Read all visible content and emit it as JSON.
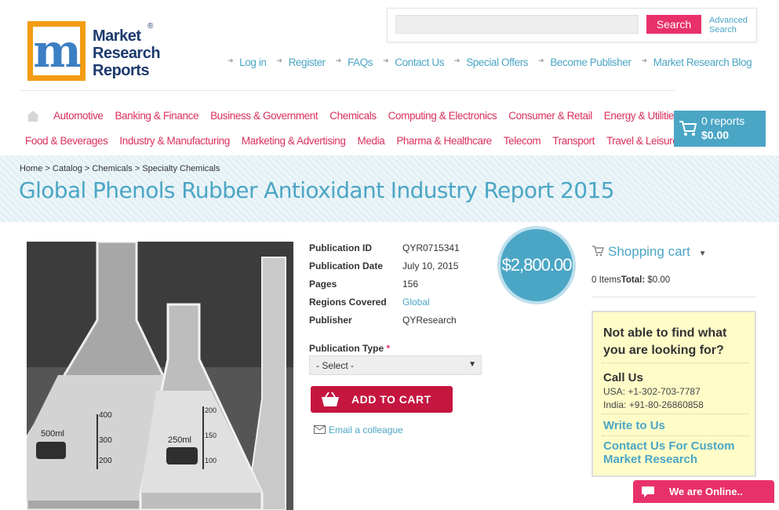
{
  "logo": {
    "letter": "m",
    "line1": "Market",
    "line2": "Research",
    "line3": "Reports",
    "reg": "®"
  },
  "search": {
    "placeholder": "",
    "button": "Search",
    "advanced_line1": "Advanced",
    "advanced_line2": "Search"
  },
  "top_links": [
    "Log in",
    "Register",
    "FAQs",
    "Contact Us",
    "Special Offers",
    "Become Publisher",
    "Market Research Blog"
  ],
  "nav_row1": [
    "Automotive",
    "Banking & Finance",
    "Business & Government",
    "Chemicals",
    "Computing & Electronics",
    "Consumer & Retail",
    "Energy & Utilities"
  ],
  "nav_row2": [
    "Food & Beverages",
    "Industry & Manufacturing",
    "Marketing & Advertising",
    "Media",
    "Pharma & Healthcare",
    "Telecom",
    "Transport",
    "Travel & Leisure"
  ],
  "cart": {
    "reports": "0 reports",
    "total": "$0.00"
  },
  "breadcrumb": {
    "home": "Home",
    "catalog": "Catalog",
    "chemicals": "Chemicals",
    "specialty": "Specialty Chemicals",
    "sep": ">"
  },
  "title": "Global Phenols Rubber Antioxidant Industry Report 2015",
  "image": {
    "flask1": "500ml",
    "flask2": "250ml",
    "ticks1": [
      "400",
      "300",
      "200"
    ],
    "ticks2": [
      "200",
      "150",
      "100"
    ]
  },
  "details": {
    "pub_id_label": "Publication ID",
    "pub_id": "QYR0715341",
    "pub_date_label": "Publication Date",
    "pub_date": "July 10, 2015",
    "pages_label": "Pages",
    "pages": "156",
    "regions_label": "Regions Covered",
    "regions": "Global",
    "publisher_label": "Publisher",
    "publisher": "QYResearch"
  },
  "pub_type": {
    "label": "Publication Type",
    "required": "*",
    "selected": "- Select -"
  },
  "add_to_cart": "ADD TO CART",
  "email_colleague": "Email a colleague",
  "price": "$2,800.00",
  "shopping_cart": {
    "title": "Shopping cart",
    "items": "0 Items",
    "total_label": "Total:",
    "total": "$0.00"
  },
  "help": {
    "heading_line1": "Not able to find what",
    "heading_line2": "you are looking for?",
    "call": "Call Us",
    "usa": "USA: +1-302-703-7787",
    "india": "India: +91-80-26860858",
    "write": "Write to Us",
    "custom_line1": "Contact Us For Custom",
    "custom_line2": "Market Research"
  },
  "chat": "We are Online..",
  "colors": {
    "accent": "#4ba6c5",
    "pink": "#e8316a",
    "cart_red": "#c5163f"
  }
}
